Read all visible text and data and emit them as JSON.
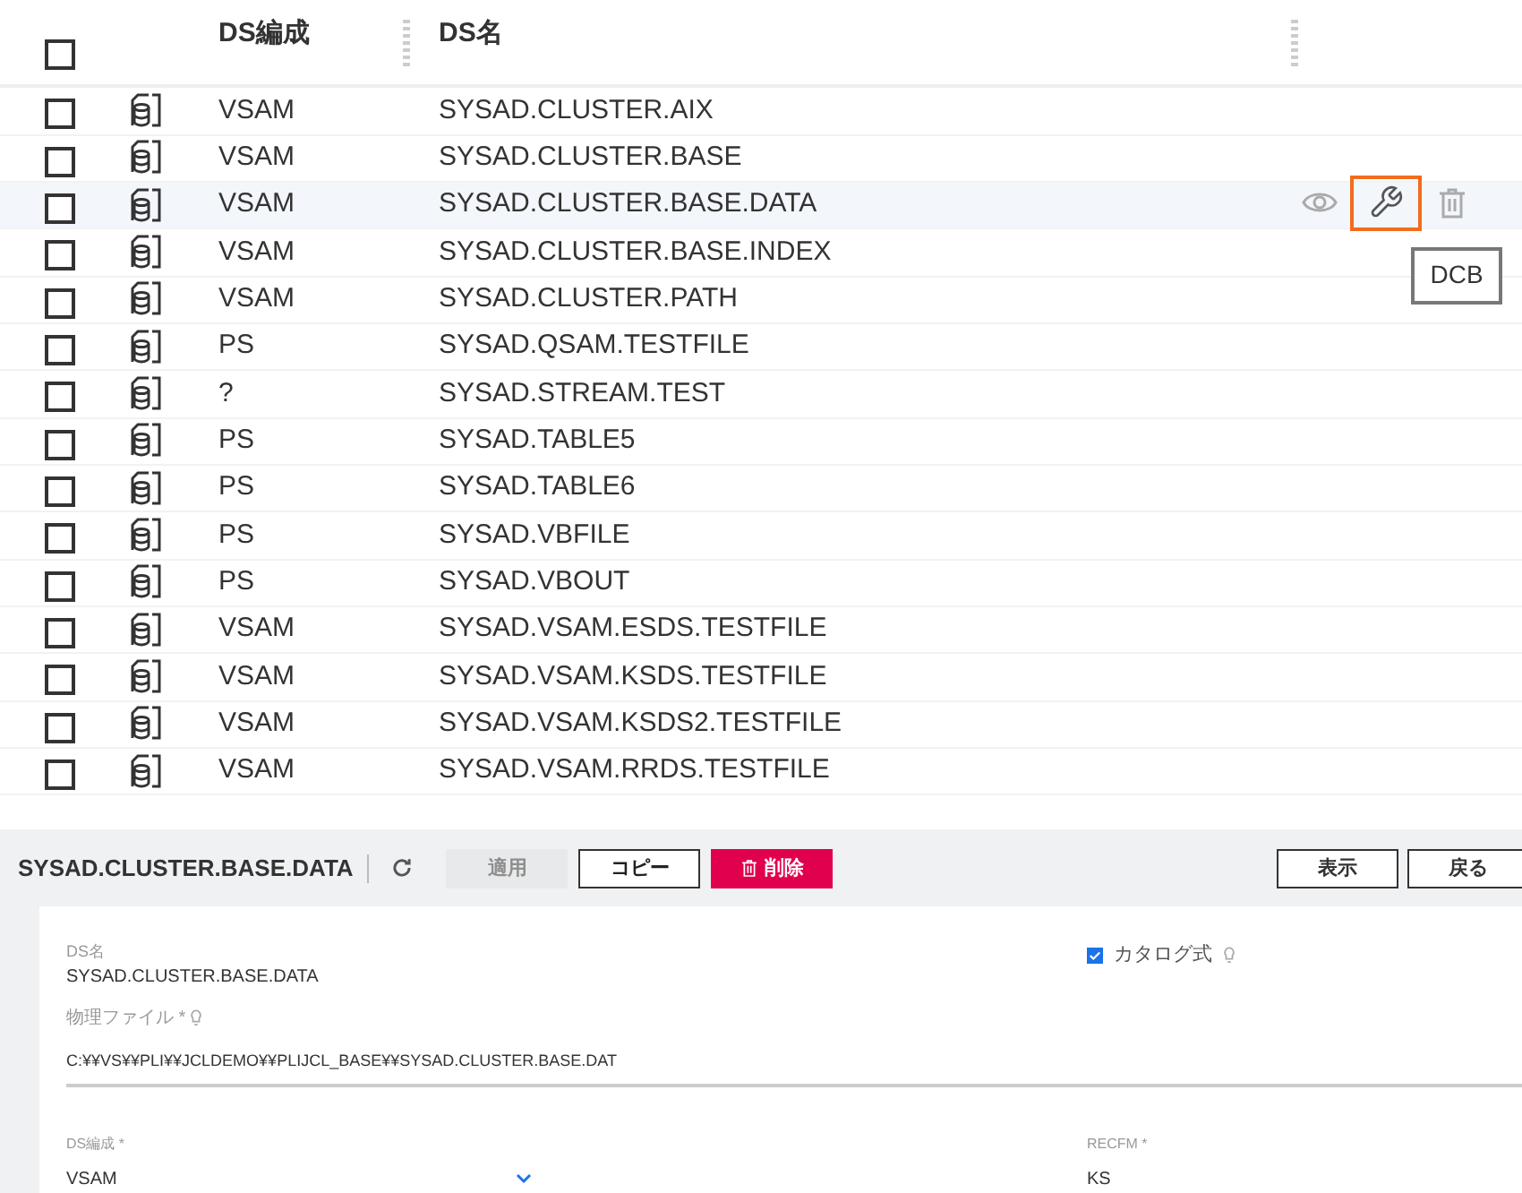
{
  "table": {
    "select_all": {
      "checked": false
    },
    "columns": [
      {
        "label": "DS編成"
      },
      {
        "label": "DS名"
      }
    ],
    "rows": [
      {
        "org": "VSAM",
        "name": "SYSAD.CLUSTER.AIX",
        "checked": false,
        "hovered": false
      },
      {
        "org": "VSAM",
        "name": "SYSAD.CLUSTER.BASE",
        "checked": false,
        "hovered": false
      },
      {
        "org": "VSAM",
        "name": "SYSAD.CLUSTER.BASE.DATA",
        "checked": false,
        "hovered": true,
        "actions": [
          {
            "kind": "view",
            "focused": false
          },
          {
            "kind": "dcb",
            "focused": true
          },
          {
            "kind": "delete",
            "focused": false
          }
        ],
        "tooltip": "DCB"
      },
      {
        "org": "VSAM",
        "name": "SYSAD.CLUSTER.BASE.INDEX",
        "checked": false,
        "hovered": false
      },
      {
        "org": "VSAM",
        "name": "SYSAD.CLUSTER.PATH",
        "checked": false,
        "hovered": false
      },
      {
        "org": "PS",
        "name": "SYSAD.QSAM.TESTFILE",
        "checked": false,
        "hovered": false
      },
      {
        "org": "?",
        "name": "SYSAD.STREAM.TEST",
        "checked": false,
        "hovered": false
      },
      {
        "org": "PS",
        "name": "SYSAD.TABLE5",
        "checked": false,
        "hovered": false
      },
      {
        "org": "PS",
        "name": "SYSAD.TABLE6",
        "checked": false,
        "hovered": false
      },
      {
        "org": "PS",
        "name": "SYSAD.VBFILE",
        "checked": false,
        "hovered": false
      },
      {
        "org": "PS",
        "name": "SYSAD.VBOUT",
        "checked": false,
        "hovered": false
      },
      {
        "org": "VSAM",
        "name": "SYSAD.VSAM.ESDS.TESTFILE",
        "checked": false,
        "hovered": false
      },
      {
        "org": "VSAM",
        "name": "SYSAD.VSAM.KSDS.TESTFILE",
        "checked": false,
        "hovered": false
      },
      {
        "org": "VSAM",
        "name": "SYSAD.VSAM.KSDS2.TESTFILE",
        "checked": false,
        "hovered": false
      },
      {
        "org": "VSAM",
        "name": "SYSAD.VSAM.RRDS.TESTFILE",
        "checked": false,
        "hovered": false
      }
    ]
  },
  "detail": {
    "title": "SYSAD.CLUSTER.BASE.DATA",
    "toolbar": [
      {
        "kind": "refresh"
      },
      {
        "kind": "button",
        "label": "適用",
        "disabled": true
      },
      {
        "kind": "button",
        "label": "コピー",
        "disabled": false
      },
      {
        "kind": "danger",
        "label": "削除",
        "disabled": false
      }
    ],
    "right_buttons": [
      {
        "label": "表示"
      },
      {
        "label": "戻る"
      }
    ],
    "ds_name": {
      "label": "DS名",
      "value": "SYSAD.CLUSTER.BASE.DATA"
    },
    "catalog": {
      "label": "カタログ式",
      "checked": true
    },
    "physical_file": {
      "label": "物理ファイル *",
      "value": "C:¥¥VS¥¥PLI¥¥JCLDEMO¥¥PLIJCL_BASE¥¥SYSAD.CLUSTER.BASE.DAT"
    },
    "ds_org": {
      "label": "DS編成 *",
      "value": "VSAM"
    },
    "recfm": {
      "label": "RECFM *",
      "value": "KS"
    }
  }
}
